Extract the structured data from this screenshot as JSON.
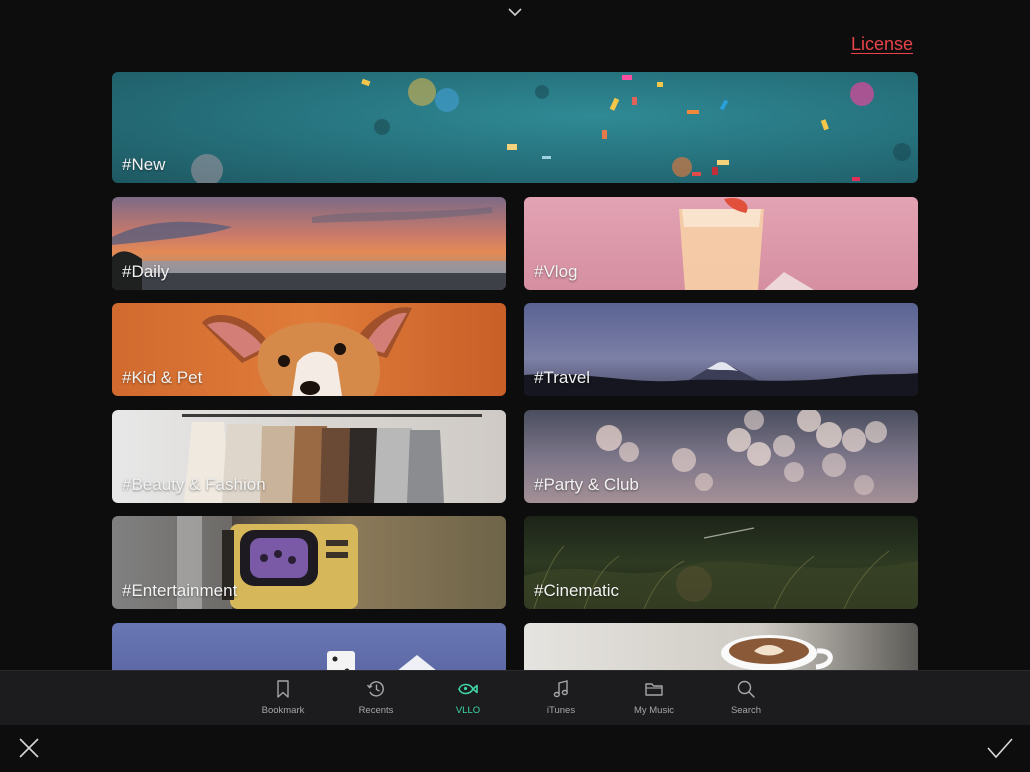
{
  "header": {
    "collapse_icon": "chevron-down-icon",
    "license_label": "License",
    "license_color": "#e8434a"
  },
  "categories": [
    {
      "label": "#New"
    },
    {
      "label": "#Daily"
    },
    {
      "label": "#Vlog"
    },
    {
      "label": "#Kid & Pet"
    },
    {
      "label": "#Travel"
    },
    {
      "label": "#Beauty & Fashion"
    },
    {
      "label": "#Party & Club"
    },
    {
      "label": "#Entertainment"
    },
    {
      "label": "#Cinematic"
    }
  ],
  "tabbar": {
    "active_color": "#3fd6a4",
    "tabs": [
      {
        "label": "Bookmark",
        "icon": "bookmark-icon"
      },
      {
        "label": "Recents",
        "icon": "clock-icon"
      },
      {
        "label": "VLLO",
        "icon": "vllo-fish-icon",
        "active": true
      },
      {
        "label": "iTunes",
        "icon": "music-note-icon"
      },
      {
        "label": "My Music",
        "icon": "folder-icon"
      },
      {
        "label": "Search",
        "icon": "search-icon"
      }
    ]
  },
  "footer": {
    "cancel_icon": "close-icon",
    "confirm_icon": "checkmark-icon"
  }
}
